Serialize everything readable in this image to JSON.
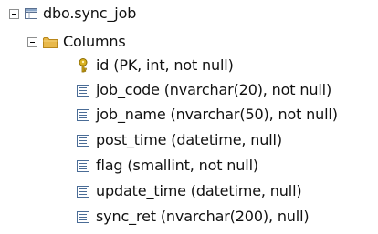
{
  "tree": {
    "table": {
      "label": "dbo.sync_job",
      "icon": "table-icon"
    },
    "folder": {
      "label": "Columns",
      "icon": "folder-icon"
    },
    "columns": [
      {
        "label": "id (PK, int, not null)",
        "icon": "primary-key-icon"
      },
      {
        "label": "job_code (nvarchar(20), not null)",
        "icon": "column-icon"
      },
      {
        "label": "job_name (nvarchar(50), not null)",
        "icon": "column-icon"
      },
      {
        "label": "post_time (datetime, null)",
        "icon": "column-icon"
      },
      {
        "label": "flag (smallint, not null)",
        "icon": "column-icon"
      },
      {
        "label": "update_time (datetime, null)",
        "icon": "column-icon"
      },
      {
        "label": "sync_ret (nvarchar(200), null)",
        "icon": "column-icon"
      }
    ]
  },
  "colors": {
    "expander_border": "#8e8f8f",
    "folder_fill": "#e8b84a",
    "folder_stroke": "#b8861a",
    "table_stroke": "#5a6f8f",
    "key_fill": "#d9b11f",
    "column_stroke": "#4a6c96"
  }
}
